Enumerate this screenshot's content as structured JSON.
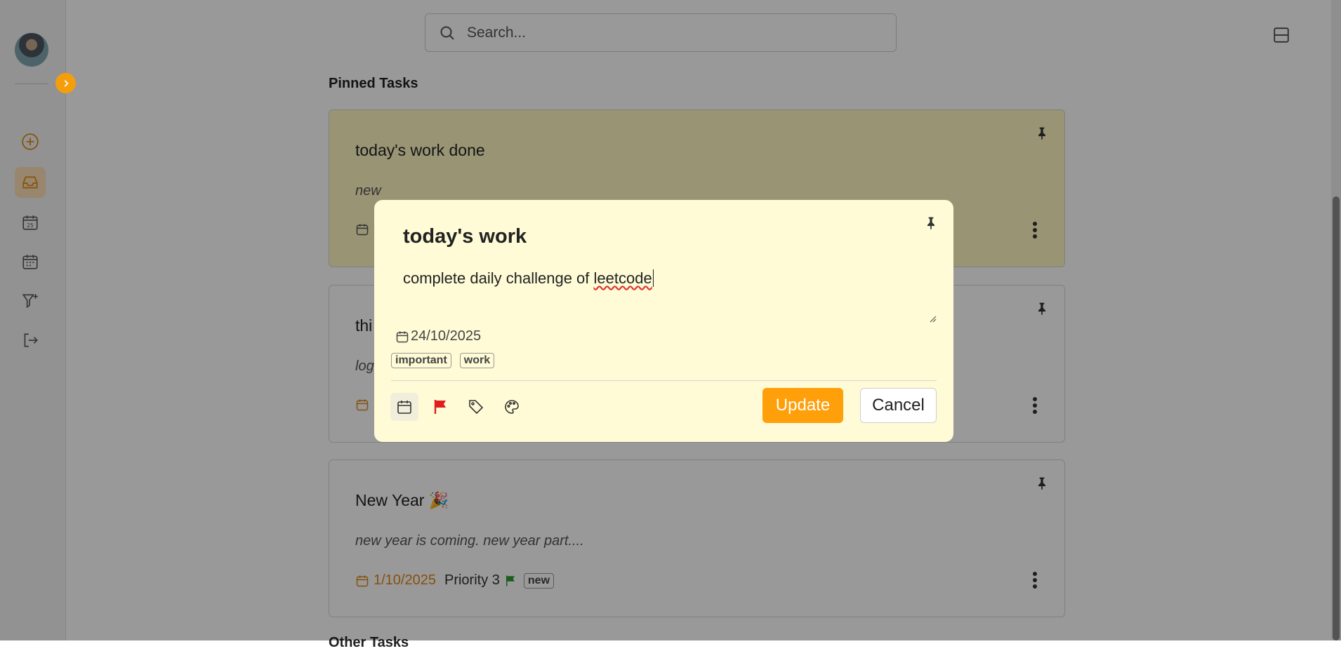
{
  "search": {
    "placeholder": "Search..."
  },
  "pinned_section": {
    "title": "Pinned Tasks"
  },
  "other_section": {
    "title": "Other Tasks"
  },
  "cards": [
    {
      "title": "today's work done",
      "description": "new",
      "date": "",
      "color": "#fff7c2"
    },
    {
      "title": "thi",
      "description": "log",
      "date": ""
    },
    {
      "title": "New Year 🎉",
      "description": "new year is coming. new year part....",
      "date": "1/10/2025",
      "priority": "Priority 3",
      "tag": "new",
      "flag_color": "#2e9b2e"
    }
  ],
  "modal": {
    "title": "today's work",
    "description_prefix": "complete daily challenge of ",
    "description_misspelled": "leetcode",
    "date": "24/10/2025",
    "tags": [
      "important",
      "work"
    ],
    "update_label": "Update",
    "cancel_label": "Cancel",
    "background": "#fffbd6"
  },
  "colors": {
    "accent": "#ff9f0a",
    "priority_flag": "#e11d1d",
    "overdue_date": "#e0861a"
  },
  "icons": [
    "add-task-icon",
    "inbox-icon",
    "today-calendar-icon",
    "calendar-icon",
    "filter-add-icon",
    "logout-icon",
    "search-icon",
    "layout-toggle-icon",
    "pin-icon",
    "kebab-menu-icon",
    "calendar-icon",
    "flag-icon",
    "tag-icon",
    "palette-icon"
  ]
}
